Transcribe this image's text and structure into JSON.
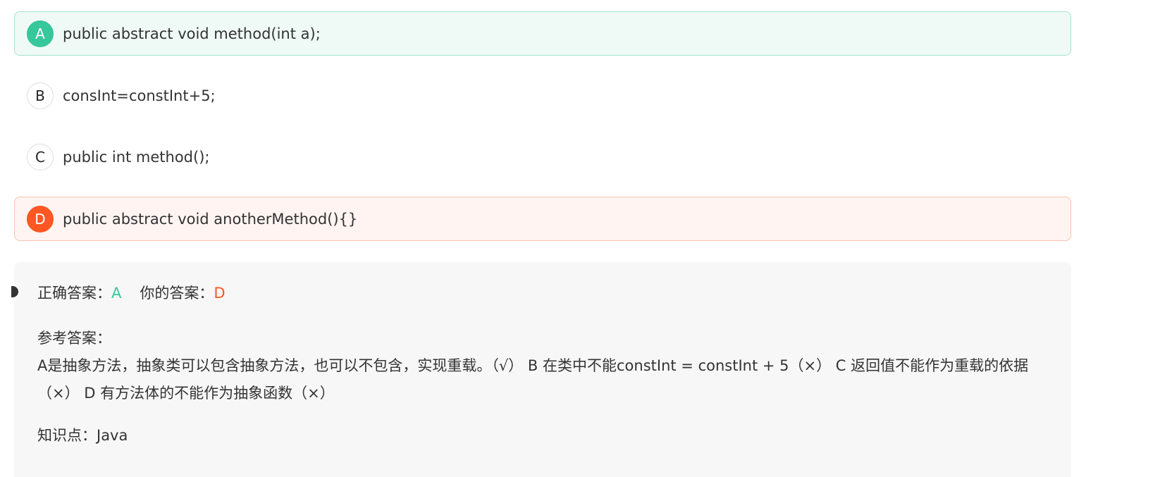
{
  "options": [
    {
      "letter": "A",
      "text": "public abstract void method(int a);",
      "state": "correct"
    },
    {
      "letter": "B",
      "text": "consInt=constInt+5;",
      "state": "normal"
    },
    {
      "letter": "C",
      "text": "public int method();",
      "state": "normal"
    },
    {
      "letter": "D",
      "text": "public abstract void anotherMethod(){}",
      "state": "wrong"
    }
  ],
  "analysis": {
    "correct_label": "正确答案：",
    "correct_value": "A",
    "your_label": "你的答案：",
    "your_value": "D",
    "ref_title": "参考答案：",
    "ref_body": "A是抽象方法，抽象类可以包含抽象方法，也可以不包含，实现重载。（√） B 在类中不能constInt = constInt + 5（×） C 返回值不能作为重载的依据（×） D 有方法体的不能作为抽象函数（×）",
    "knowledge_label": "知识点：",
    "knowledge_value": "Java"
  },
  "colors": {
    "correct": "#36c79b",
    "wrong": "#ff5722"
  }
}
